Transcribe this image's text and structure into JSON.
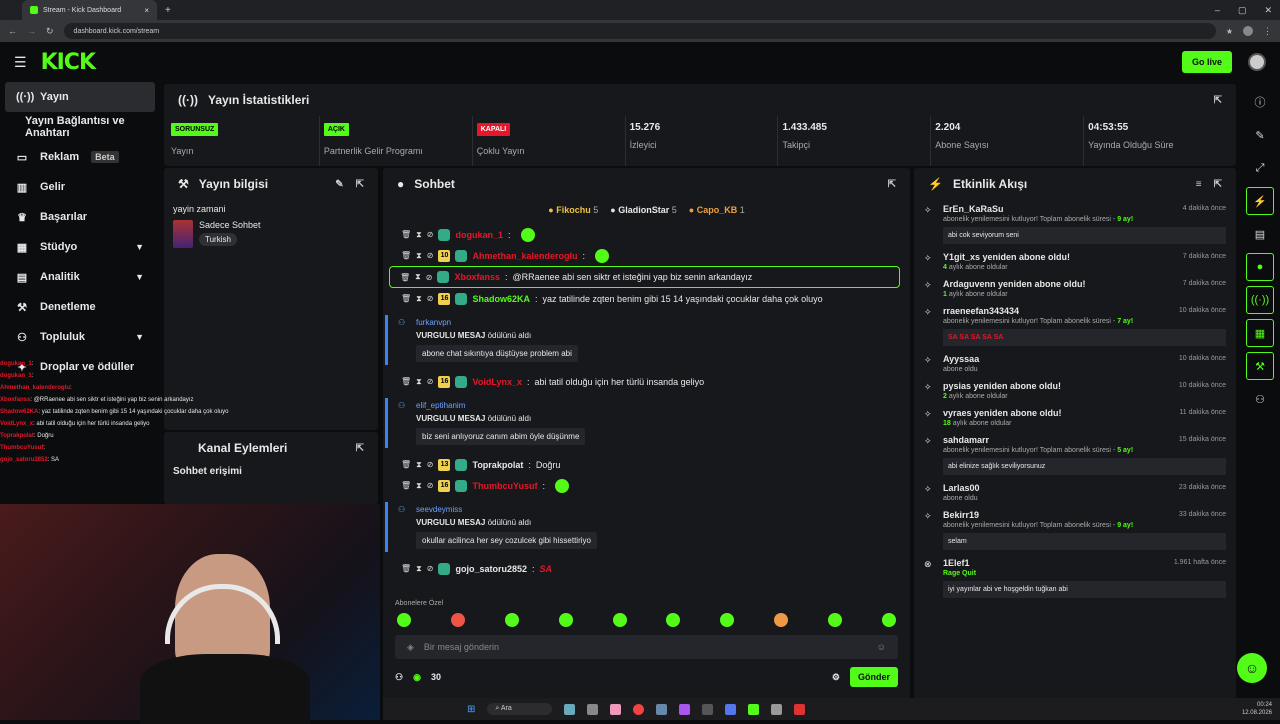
{
  "browser": {
    "tab_title": "Stream - Kick Dashboard",
    "url": "dashboard.kick.com/stream"
  },
  "header": {
    "logo": "KICK",
    "go_live": "Go live"
  },
  "sidebar": {
    "items": [
      {
        "label": "Yayın",
        "icon": "broadcast-icon"
      },
      {
        "label": "Yayın Bağlantısı ve Anahtarı"
      },
      {
        "label": "Reklam",
        "badge": "Beta",
        "icon": "tv-icon"
      },
      {
        "label": "Gelir",
        "icon": "chart-icon"
      },
      {
        "label": "Başarılar",
        "icon": "trophy-icon"
      },
      {
        "label": "Stüdyo",
        "icon": "grid-icon"
      },
      {
        "label": "Analitik",
        "icon": "analytics-icon"
      },
      {
        "label": "Denetleme",
        "icon": "hammer-icon"
      },
      {
        "label": "Topluluk",
        "icon": "community-icon"
      },
      {
        "label": "Droplar ve ödüller",
        "icon": "gift-icon"
      }
    ]
  },
  "stats": {
    "title": "Yayın İstatistikleri",
    "cells": [
      {
        "badge": "SORUNSUZ",
        "badge_color": "#53fc18",
        "label": "Yayın"
      },
      {
        "badge": "AÇIK",
        "badge_color": "#53fc18",
        "label": "Partnerlik Gelir Programı"
      },
      {
        "badge": "KAPALI",
        "badge_color": "#e5172a",
        "label": "Çoklu Yayın"
      },
      {
        "value": "15.276",
        "label": "İzleyici"
      },
      {
        "value": "1.433.485",
        "label": "Takipçi"
      },
      {
        "value": "2.204",
        "label": "Abone Sayısı"
      },
      {
        "value": "04:53:55",
        "label": "Yayında Olduğu Süre"
      }
    ]
  },
  "info": {
    "title": "Yayın bilgisi",
    "stream_title": "yayin zamani",
    "category": "Sadece Sohbet",
    "tag": "Turkish"
  },
  "kanal": {
    "title": "Kanal Eylemleri",
    "sub": "Sohbet erişimi"
  },
  "chat": {
    "title": "Sohbet",
    "top": [
      {
        "name": "Fikochu",
        "n": "5",
        "color": "#f0c040"
      },
      {
        "name": "GladionStar",
        "n": "5",
        "color": "#ddd"
      },
      {
        "name": "Capo_KB",
        "n": "1",
        "color": "#f0a040"
      }
    ],
    "messages": [
      {
        "type": "msg",
        "user": "dogukan_1",
        "color": "#e5172a",
        "text": ""
      },
      {
        "type": "msg",
        "sub": "10",
        "user": "Ahmethan_kalenderoglu",
        "color": "#e5172a",
        "text": ""
      },
      {
        "type": "hl",
        "user": "Xboxfanss",
        "color": "#e5172a",
        "text": "@RRaenee abi sen siktr et isteğini yap biz senin arkandayız"
      },
      {
        "type": "msg",
        "sub": "16",
        "user": "Shadow62KA",
        "color": "#53fc18",
        "text": "yaz tatilinde zqten benim gibi 15 14 yaşındaki çocuklar daha çok oluyo"
      },
      {
        "type": "vurg",
        "user": "furkanvpn",
        "label": "VURGULU MESAJ",
        "suffix": "ödülünü aldı",
        "text": "abone chat sıkıntıya düştüyse problem abi"
      },
      {
        "type": "msg",
        "sub": "16",
        "user": "VoidLynx_x",
        "color": "#e5172a",
        "text": "abi tatil olduğu için her türlü insanda geliyo"
      },
      {
        "type": "vurg",
        "user": "elif_eptihanim",
        "label": "VURGULU MESAJ",
        "suffix": "ödülünü aldı",
        "text": "biz seni anlıyoruz canım abim öyle düşünme"
      },
      {
        "type": "msg",
        "sub": "13",
        "user": "Toprakpolat",
        "color": "#e8e8e8",
        "text": "Doğru"
      },
      {
        "type": "msg",
        "sub": "16",
        "user": "ThumbcuYusuf",
        "color": "#e5172a",
        "text": ""
      },
      {
        "type": "vurg",
        "user": "seevdeymiss",
        "label": "VURGULU MESAJ",
        "suffix": "ödülünü aldı",
        "text": "okullar acilinca her sey cozulcek gibi hissettiriyo"
      },
      {
        "type": "msg",
        "user": "gojo_satoru2852",
        "color": "#e8e8e8",
        "text": "SA"
      }
    ],
    "emote_title": "Abonelere Özel",
    "input_placeholder": "Bir mesaj gönderin",
    "points": "30",
    "send": "Gönder"
  },
  "activity": {
    "title": "Etkinlik Akışı",
    "events": [
      {
        "name": "ErEn_KaRaSu",
        "time": "4 dakika önce",
        "sub": "abonelik yenilemesini kutluyor! Toplam abonelik süresi -",
        "months": "9 ay!",
        "msg": "abi cok seviyorum seni"
      },
      {
        "name": "Y1git_xs yeniden abone oldu!",
        "time": "7 dakika önce",
        "count": "4",
        "sub": "aylık abone oldular"
      },
      {
        "name": "Ardaguvenn yeniden abone oldu!",
        "time": "7 dakika önce",
        "count": "1",
        "sub": "aylık abone oldular"
      },
      {
        "name": "rraeneefan343434",
        "time": "10 dakika önce",
        "sub": "abonelik yenilemesini kutluyor! Toplam abonelik süresi -",
        "months": "7 ay!",
        "msg": "SA SA SA SA SA"
      },
      {
        "name": "Ayyssaa",
        "time": "10 dakika önce",
        "sub": "abone oldu"
      },
      {
        "name": "pysias yeniden abone oldu!",
        "time": "10 dakika önce",
        "count": "2",
        "sub": "aylık abone oldular"
      },
      {
        "name": "vyraes yeniden abone oldu!",
        "time": "11 dakika önce",
        "count": "18",
        "sub": "aylık abone oldular"
      },
      {
        "name": "sahdamarr",
        "time": "15 dakika önce",
        "sub": "abonelik yenilemesini kutluyor! Toplam abonelik süresi -",
        "months": "5 ay!",
        "msg": "abi elinize sağlık seviliyorsunuz"
      },
      {
        "name": "Larlas00",
        "time": "23 dakika önce",
        "sub": "abone oldu"
      },
      {
        "name": "Bekirr19",
        "time": "33 dakika önce",
        "sub": "abonelik yenilemesini kutluyor! Toplam abonelik süresi -",
        "months": "9 ay!",
        "msg": "selam"
      },
      {
        "name": "1Elef1",
        "time": "1.961 hafta önce",
        "reward": "Rage Quit",
        "msg": "iyi yayınlar abi ve hoşgeldin tuğkan abi"
      }
    ]
  },
  "overlay": {
    "lines": [
      {
        "u": "dogukan_1",
        "t": ""
      },
      {
        "u": "dogukan_1",
        "t": ""
      },
      {
        "u": "Ahmethan_kalenderoglu",
        "t": ""
      },
      {
        "u": "Xboxfanss",
        "t": "@RRaenee abi sen siktr et isteğini yap biz senin arkandayız"
      },
      {
        "u": "Shadow62KA",
        "t": "yaz tatilinde zqten benim gibi 15 14 yaşındaki çocuklar daha çok oluyo"
      },
      {
        "u": "VoidLynx_x",
        "t": "abi tatil olduğu için her türlü insanda geliyo"
      },
      {
        "u": "Toprakpolat",
        "t": "Doğru"
      },
      {
        "u": "ThumbcuYusuf",
        "t": ""
      },
      {
        "u": "gojo_satoru2852",
        "t": "SA"
      }
    ]
  },
  "taskbar": {
    "search": "Ara",
    "time": "00:24",
    "date": "12.08.2026"
  }
}
